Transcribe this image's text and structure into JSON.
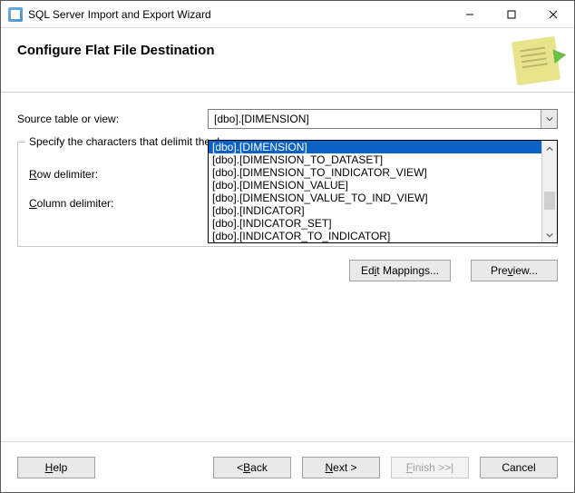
{
  "window": {
    "title": "SQL Server Import and Export Wizard"
  },
  "header": {
    "title": "Configure Flat File Destination"
  },
  "labels": {
    "source": "Source table or view:",
    "group_legend": "Specify the characters that delimit the destination file:",
    "group_legend_truncated": "Specify the characters that delimit the d",
    "row_delimiter": "Row delimiter:",
    "row_delimiter_html": "<span class='ul'>R</span>ow delimiter:",
    "column_delimiter": "Column delimiter:",
    "column_delimiter_html": "<span class='ul'>C</span>olumn delimiter:"
  },
  "select": {
    "value": "[dbo].[DIMENSION]",
    "options": [
      "[dbo].[DIMENSION]",
      "[dbo].[DIMENSION_TO_DATASET]",
      "[dbo].[DIMENSION_TO_INDICATOR_VIEW]",
      "[dbo].[DIMENSION_VALUE]",
      "[dbo].[DIMENSION_VALUE_TO_IND_VIEW]",
      "[dbo].[INDICATOR]",
      "[dbo].[INDICATOR_SET]",
      "[dbo].[INDICATOR_TO_INDICATOR]"
    ],
    "selected_index": 0
  },
  "buttons": {
    "edit_mappings": "Edit Mappings...",
    "edit_mappings_html": "Ed<span class='ul'>i</span>t Mappings...",
    "preview": "Preview...",
    "preview_html": "Pre<span class='ul'>v</span>iew...",
    "help": "Help",
    "help_html": "<span class='ul'>H</span>elp",
    "back": "< Back",
    "back_html": "&lt; <span class='ul'>B</span>ack",
    "next": "Next >",
    "next_html": "<span class='ul'>N</span>ext &gt;",
    "finish": "Finish >>|",
    "finish_html": "<span class='ul'>F</span>inish &gt;&gt;|",
    "cancel": "Cancel"
  }
}
